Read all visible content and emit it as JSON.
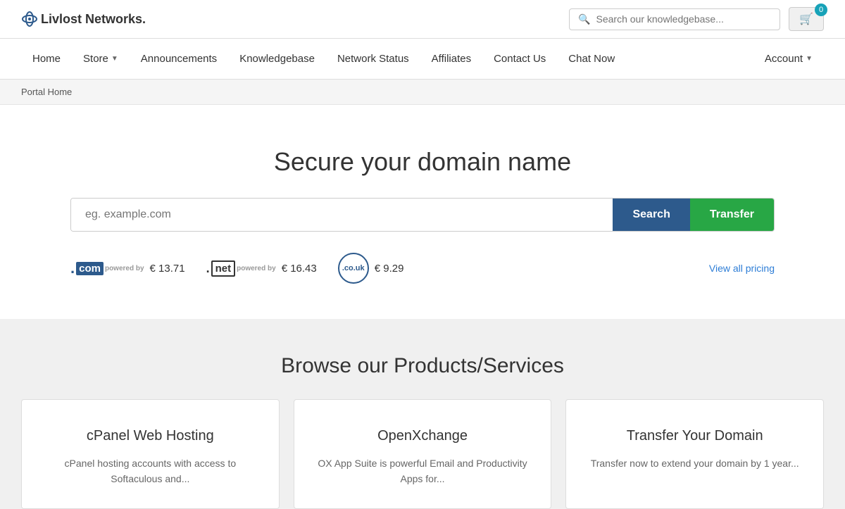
{
  "logo": {
    "text": "Livlost Networks."
  },
  "header": {
    "search_placeholder": "Search our knowledgebase...",
    "cart_count": "0"
  },
  "nav": {
    "items": [
      {
        "label": "Home",
        "has_dropdown": false
      },
      {
        "label": "Store",
        "has_dropdown": true
      },
      {
        "label": "Announcements",
        "has_dropdown": false
      },
      {
        "label": "Knowledgebase",
        "has_dropdown": false
      },
      {
        "label": "Network Status",
        "has_dropdown": false
      },
      {
        "label": "Affiliates",
        "has_dropdown": false
      },
      {
        "label": "Contact Us",
        "has_dropdown": false
      },
      {
        "label": "Chat Now",
        "has_dropdown": false
      },
      {
        "label": "Account",
        "has_dropdown": true
      }
    ]
  },
  "breadcrumb": {
    "label": "Portal Home"
  },
  "hero": {
    "title": "Secure your domain name",
    "search_placeholder": "eg. example.com",
    "search_button": "Search",
    "transfer_button": "Transfer",
    "pricing": [
      {
        "tld": ".com",
        "price": "€ 13.71"
      },
      {
        "tld": ".net",
        "price": "€ 16.43"
      },
      {
        "tld": ".co.uk",
        "price": "€ 9.29"
      }
    ],
    "view_pricing": "View all pricing"
  },
  "products": {
    "title": "Browse our Products/Services",
    "cards": [
      {
        "title": "cPanel Web Hosting",
        "description": "cPanel hosting accounts with access to Softaculous and..."
      },
      {
        "title": "OpenXchange",
        "description": "OX App Suite is powerful Email and Productivity Apps for..."
      },
      {
        "title": "Transfer Your Domain",
        "description": "Transfer now to extend your domain by 1 year..."
      }
    ]
  }
}
